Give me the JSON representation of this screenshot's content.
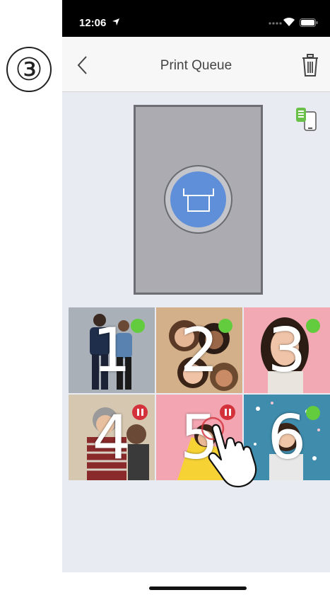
{
  "step": {
    "number": "③"
  },
  "status_bar": {
    "time": "12:06"
  },
  "nav": {
    "title": "Print Queue"
  },
  "icons": {
    "back": "chevron-left-icon",
    "trash": "trash-icon",
    "printer_status": "printer-battery-icon",
    "print": "printer-tray-icon",
    "hand": "hand-pointer-icon"
  },
  "queue": [
    {
      "number": "1",
      "status": "ready"
    },
    {
      "number": "2",
      "status": "ready"
    },
    {
      "number": "3",
      "status": "ready"
    },
    {
      "number": "4",
      "status": "paused"
    },
    {
      "number": "5",
      "status": "paused"
    },
    {
      "number": "6",
      "status": "ready"
    }
  ],
  "colors": {
    "accent_blue": "#5f8fd8",
    "ready_green": "#62cb3e",
    "paused_red": "#d3323a",
    "background": "#e8ebf1"
  }
}
